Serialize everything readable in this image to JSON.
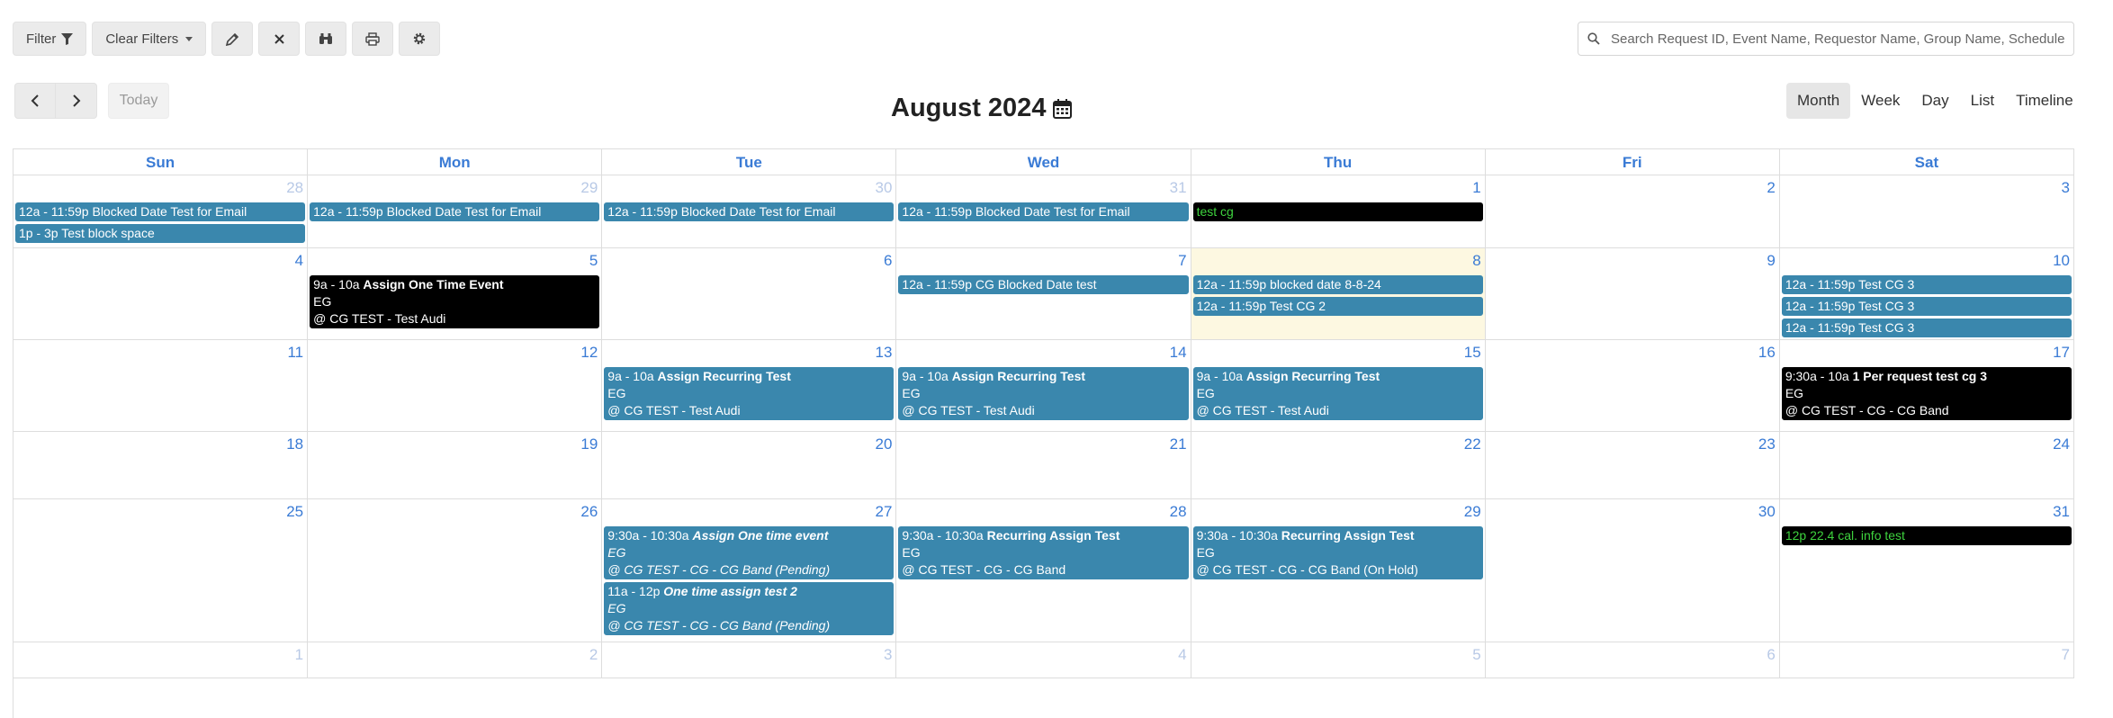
{
  "toolbar": {
    "filter_label": "Filter",
    "clear_filters_label": "Clear Filters"
  },
  "search": {
    "placeholder": "Search Request ID, Event Name, Requestor Name, Group Name, Schedule ID"
  },
  "nav": {
    "today_label": "Today"
  },
  "calendar": {
    "title": "August 2024",
    "views": [
      "Month",
      "Week",
      "Day",
      "List",
      "Timeline"
    ],
    "active_view": "Month",
    "days_of_week": [
      "Sun",
      "Mon",
      "Tue",
      "Wed",
      "Thu",
      "Fri",
      "Sat"
    ],
    "weeks": [
      {
        "days": [
          {
            "num": "28",
            "other": true,
            "events": [
              {
                "color": "blue",
                "time": "12a - 11:59p",
                "title": "Blocked Date Test for Email"
              },
              {
                "color": "blue",
                "time": "1p - 3p",
                "title": "Test block space"
              }
            ]
          },
          {
            "num": "29",
            "other": true,
            "events": [
              {
                "color": "blue",
                "time": "12a - 11:59p",
                "title": "Blocked Date Test for Email"
              }
            ]
          },
          {
            "num": "30",
            "other": true,
            "events": [
              {
                "color": "blue",
                "time": "12a - 11:59p",
                "title": "Blocked Date Test for Email"
              }
            ]
          },
          {
            "num": "31",
            "other": true,
            "events": [
              {
                "color": "blue",
                "time": "12a - 11:59p",
                "title": "Blocked Date Test for Email"
              }
            ]
          },
          {
            "num": "1",
            "other": false,
            "events": [
              {
                "color": "black-green",
                "time": "",
                "title": "test cg"
              }
            ]
          },
          {
            "num": "2",
            "other": false,
            "events": []
          },
          {
            "num": "3",
            "other": false,
            "events": []
          }
        ]
      },
      {
        "days": [
          {
            "num": "4",
            "other": false,
            "events": []
          },
          {
            "num": "5",
            "other": false,
            "events": [
              {
                "color": "black",
                "time": "9a - 10a",
                "title": "Assign One Time Event",
                "bold": true,
                "group": "EG",
                "location": "@ CG TEST - Test Audi"
              }
            ]
          },
          {
            "num": "6",
            "other": false,
            "events": []
          },
          {
            "num": "7",
            "other": false,
            "events": [
              {
                "color": "blue",
                "time": "12a - 11:59p",
                "title": "CG Blocked Date test"
              }
            ]
          },
          {
            "num": "8",
            "other": false,
            "highlight": true,
            "events": [
              {
                "color": "blue",
                "time": "12a - 11:59p",
                "title": "blocked date 8-8-24"
              },
              {
                "color": "blue",
                "time": "12a - 11:59p",
                "title": "Test CG 2"
              }
            ]
          },
          {
            "num": "9",
            "other": false,
            "events": []
          },
          {
            "num": "10",
            "other": false,
            "events": [
              {
                "color": "blue",
                "time": "12a - 11:59p",
                "title": "Test CG 3"
              },
              {
                "color": "blue",
                "time": "12a - 11:59p",
                "title": "Test CG 3"
              },
              {
                "color": "blue",
                "time": "12a - 11:59p",
                "title": "Test CG 3"
              }
            ]
          }
        ]
      },
      {
        "days": [
          {
            "num": "11",
            "other": false,
            "events": []
          },
          {
            "num": "12",
            "other": false,
            "events": []
          },
          {
            "num": "13",
            "other": false,
            "events": [
              {
                "color": "blue",
                "time": "9a - 10a",
                "title": "Assign Recurring Test",
                "bold": true,
                "group": "EG",
                "location": "@ CG TEST - Test Audi"
              }
            ]
          },
          {
            "num": "14",
            "other": false,
            "events": [
              {
                "color": "blue",
                "time": "9a - 10a",
                "title": "Assign Recurring Test",
                "bold": true,
                "group": "EG",
                "location": "@ CG TEST - Test Audi"
              }
            ]
          },
          {
            "num": "15",
            "other": false,
            "events": [
              {
                "color": "blue",
                "time": "9a - 10a",
                "title": "Assign Recurring Test",
                "bold": true,
                "group": "EG",
                "location": "@ CG TEST - Test Audi"
              }
            ]
          },
          {
            "num": "16",
            "other": false,
            "events": []
          },
          {
            "num": "17",
            "other": false,
            "events": [
              {
                "color": "black",
                "time": "9:30a - 10a",
                "title": "1 Per request test cg 3",
                "bold": true,
                "group": "EG",
                "location": "@ CG TEST - CG - CG Band"
              }
            ]
          }
        ]
      },
      {
        "days": [
          {
            "num": "18",
            "other": false,
            "events": []
          },
          {
            "num": "19",
            "other": false,
            "events": []
          },
          {
            "num": "20",
            "other": false,
            "events": []
          },
          {
            "num": "21",
            "other": false,
            "events": []
          },
          {
            "num": "22",
            "other": false,
            "events": []
          },
          {
            "num": "23",
            "other": false,
            "events": []
          },
          {
            "num": "24",
            "other": false,
            "events": []
          }
        ]
      },
      {
        "days": [
          {
            "num": "25",
            "other": false,
            "events": []
          },
          {
            "num": "26",
            "other": false,
            "events": []
          },
          {
            "num": "27",
            "other": false,
            "events": [
              {
                "color": "blue",
                "time": "9:30a - 10:30a",
                "title": "Assign One time event",
                "bold": true,
                "italic": true,
                "group": "EG",
                "location": "@ CG TEST - CG - CG Band (Pending)"
              },
              {
                "color": "blue",
                "time": "11a - 12p",
                "title": "One time assign test 2",
                "bold": true,
                "italic": true,
                "group": "EG",
                "location": "@ CG TEST - CG - CG Band (Pending)"
              }
            ]
          },
          {
            "num": "28",
            "other": false,
            "events": [
              {
                "color": "blue",
                "time": "9:30a - 10:30a",
                "title": "Recurring Assign Test",
                "bold": true,
                "group": "EG",
                "location": "@ CG TEST - CG - CG Band"
              }
            ]
          },
          {
            "num": "29",
            "other": false,
            "events": [
              {
                "color": "blue",
                "time": "9:30a - 10:30a",
                "title": "Recurring Assign Test",
                "bold": true,
                "group": "EG",
                "location": "@ CG TEST - CG - CG Band (On Hold)"
              }
            ]
          },
          {
            "num": "30",
            "other": false,
            "events": []
          },
          {
            "num": "31",
            "other": false,
            "events": [
              {
                "color": "black-green",
                "time": "12p",
                "title": "22.4 cal. info test"
              }
            ]
          }
        ]
      },
      {
        "days": [
          {
            "num": "1",
            "other": true,
            "events": []
          },
          {
            "num": "2",
            "other": true,
            "events": []
          },
          {
            "num": "3",
            "other": true,
            "events": []
          },
          {
            "num": "4",
            "other": true,
            "events": []
          },
          {
            "num": "5",
            "other": true,
            "events": []
          },
          {
            "num": "6",
            "other": true,
            "events": []
          },
          {
            "num": "7",
            "other": true,
            "events": []
          }
        ]
      }
    ]
  },
  "colors": {
    "event_blue": "#3a87ad",
    "event_black": "#000000",
    "event_green_text": "#3ed33e",
    "day_number": "#3a7bd5",
    "today_highlight": "#fdf8e1"
  }
}
